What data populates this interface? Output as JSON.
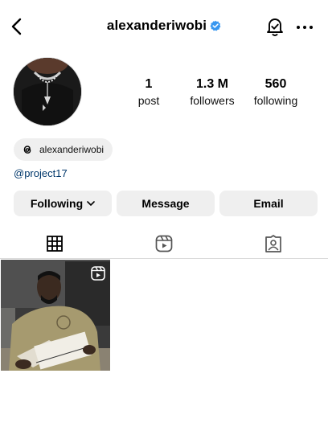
{
  "header": {
    "username": "alexanderiwobi",
    "icons": {
      "back": "back-arrow-icon",
      "verified": "verified-badge-icon",
      "notifications": "notification-bell-icon",
      "more": "more-options-icon"
    }
  },
  "profile": {
    "stats": [
      {
        "value": "1",
        "label": "post"
      },
      {
        "value": "1.3 M",
        "label": "followers"
      },
      {
        "value": "560",
        "label": "following"
      }
    ],
    "threads_handle": "alexanderiwobi",
    "bio_link": "@project17"
  },
  "actions": {
    "following_label": "Following",
    "message_label": "Message",
    "email_label": "Email"
  },
  "tabs": [
    {
      "name": "grid",
      "icon": "grid-icon",
      "active": true
    },
    {
      "name": "reels",
      "icon": "reels-icon",
      "active": false
    },
    {
      "name": "tagged",
      "icon": "tagged-icon",
      "active": false
    }
  ],
  "posts": [
    {
      "type": "reel",
      "badge_icon": "reel-badge-icon"
    }
  ],
  "colors": {
    "accent_link": "#00376b",
    "verified": "#3897f0",
    "button_bg": "#efefef"
  }
}
